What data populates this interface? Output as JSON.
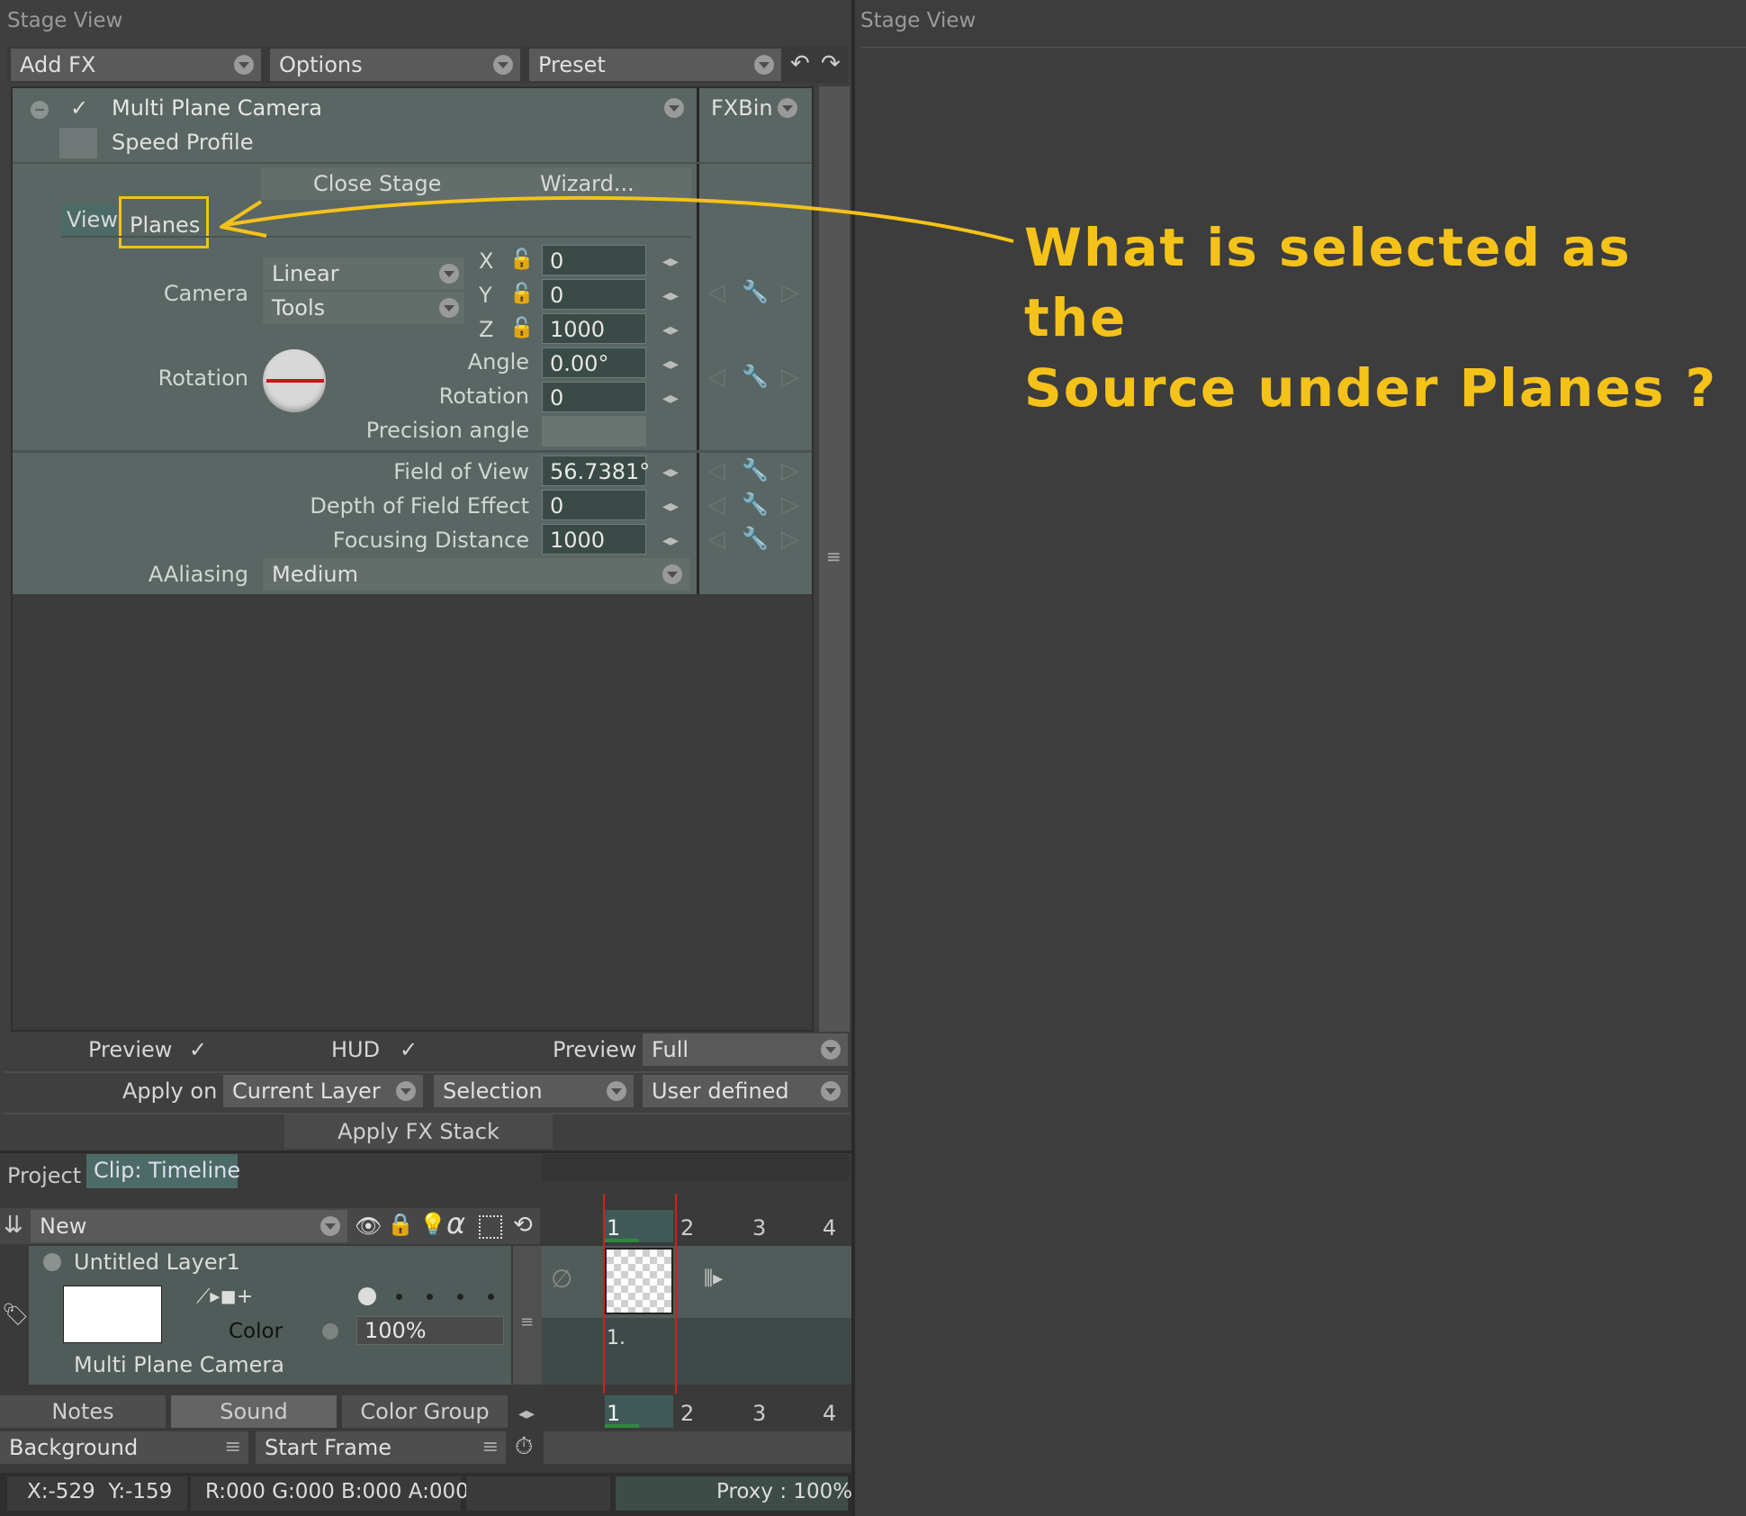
{
  "left_title": "Stage View",
  "right_title": "Stage View",
  "toolbar": {
    "add_fx": "Add FX",
    "options": "Options",
    "preset": "Preset"
  },
  "fx": {
    "name": "Multi Plane Camera",
    "speed_profile": "Speed Profile",
    "fxbin": "FXBin",
    "close_stage": "Close Stage",
    "wizard": "Wizard...",
    "tab_view": "View",
    "tab_planes": "Planes",
    "camera_label": "Camera",
    "camera_mode": "Linear",
    "camera_tools": "Tools",
    "x_label": "X",
    "x_value": "0",
    "y_label": "Y",
    "y_value": "0",
    "z_label": "Z",
    "z_value": "1000",
    "rotation_group": "Rotation",
    "angle_label": "Angle",
    "angle_value": "0.00°",
    "rotation_label": "Rotation",
    "rotation_value": "0",
    "precision_label": "Precision angle",
    "fov_label": "Field of View",
    "fov_value": "56.7381°",
    "dof_label": "Depth of Field Effect",
    "dof_value": "0",
    "focus_label": "Focusing Distance",
    "focus_value": "1000",
    "aaliasing_label": "AAliasing",
    "aaliasing_value": "Medium"
  },
  "bottom_controls": {
    "preview1": "Preview",
    "hud": "HUD",
    "preview2": "Preview",
    "preview_value": "Full",
    "apply_on": "Apply on",
    "current_layer": "Current Layer",
    "selection": "Selection",
    "user_defined": "User defined",
    "apply_stack": "Apply FX Stack"
  },
  "timeline": {
    "tab_project": "Project",
    "tab_clip": "Clip: Timeline",
    "new": "New",
    "frames": [
      "1",
      "2",
      "3",
      "4"
    ],
    "layer_name": "Untitled Layer1",
    "color_label": "Color",
    "opacity": "100%",
    "layer_fx": "Multi Plane Camera",
    "frame_label": "1.",
    "notes": "Notes",
    "sound": "Sound",
    "color_group": "Color Group",
    "background": "Background",
    "start_frame": "Start Frame"
  },
  "status": {
    "coords": "X:-529  Y:-159",
    "rgba": "R:000 G:000 B:000 A:000",
    "proxy": "Proxy : 100%"
  },
  "annotation": {
    "line1": "What is selected as the",
    "line2": "Source under Planes ?",
    "color": "#f5c21a"
  }
}
